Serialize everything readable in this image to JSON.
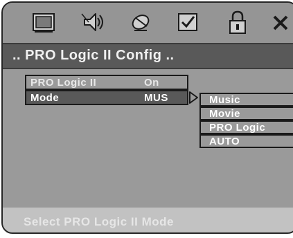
{
  "icons": [
    {
      "name": "display-icon"
    },
    {
      "name": "speaker-icon"
    },
    {
      "name": "satellite-icon"
    },
    {
      "name": "checkbox-icon"
    },
    {
      "name": "lock-icon"
    },
    {
      "name": "close-icon"
    }
  ],
  "header": {
    "title": ".. PRO Logic II Config .."
  },
  "menu": {
    "rows": [
      {
        "label": "PRO Logic II",
        "value": "On"
      },
      {
        "label": "Mode",
        "value": "MUS"
      }
    ]
  },
  "submenu": {
    "options": [
      "Music",
      "Movie",
      "PRO Logic",
      "AUTO"
    ],
    "highlighted": "Music"
  },
  "status": {
    "text": "Select PRO Logic II Mode"
  },
  "colors": {
    "background": "#9a9a9a",
    "title_bar": "#595959",
    "selected_row": "#595959",
    "status_bar": "#c2c2c2",
    "text": "#ffffff"
  }
}
